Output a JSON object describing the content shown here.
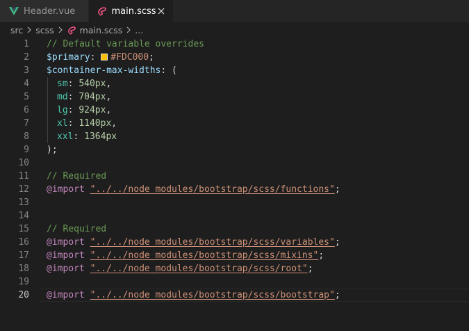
{
  "tabs": [
    {
      "label": "Header.vue",
      "icon": "vue-icon",
      "active": false
    },
    {
      "label": "main.scss",
      "icon": "sass-icon",
      "active": true
    }
  ],
  "breadcrumb": {
    "items": [
      "src",
      "scss",
      "main.scss",
      "..."
    ]
  },
  "editor": {
    "current_line": 20,
    "lines": [
      {
        "n": "1",
        "tokens": [
          {
            "t": "comment",
            "v": "// Default variable overrides"
          }
        ]
      },
      {
        "n": "2",
        "tokens": [
          {
            "t": "var",
            "v": "$primary"
          },
          {
            "t": "punc",
            "v": ": "
          },
          {
            "t": "swatch",
            "v": "#FDC000"
          },
          {
            "t": "hex",
            "v": "#FDC000"
          },
          {
            "t": "punc",
            "v": ";"
          }
        ]
      },
      {
        "n": "3",
        "tokens": [
          {
            "t": "var",
            "v": "$container-max-widths"
          },
          {
            "t": "punc",
            "v": ": ("
          }
        ]
      },
      {
        "n": "4",
        "tokens": [
          {
            "t": "indent"
          },
          {
            "t": "key",
            "v": "sm"
          },
          {
            "t": "punc",
            "v": ": "
          },
          {
            "t": "num",
            "v": "540px"
          },
          {
            "t": "punc",
            "v": ","
          }
        ]
      },
      {
        "n": "5",
        "tokens": [
          {
            "t": "indent"
          },
          {
            "t": "key",
            "v": "md"
          },
          {
            "t": "punc",
            "v": ": "
          },
          {
            "t": "num",
            "v": "704px"
          },
          {
            "t": "punc",
            "v": ","
          }
        ]
      },
      {
        "n": "6",
        "tokens": [
          {
            "t": "indent"
          },
          {
            "t": "key",
            "v": "lg"
          },
          {
            "t": "punc",
            "v": ": "
          },
          {
            "t": "num",
            "v": "924px"
          },
          {
            "t": "punc",
            "v": ","
          }
        ]
      },
      {
        "n": "7",
        "tokens": [
          {
            "t": "indent"
          },
          {
            "t": "key",
            "v": "xl"
          },
          {
            "t": "punc",
            "v": ": "
          },
          {
            "t": "num",
            "v": "1140px"
          },
          {
            "t": "punc",
            "v": ","
          }
        ]
      },
      {
        "n": "8",
        "tokens": [
          {
            "t": "indent"
          },
          {
            "t": "key",
            "v": "xxl"
          },
          {
            "t": "punc",
            "v": ": "
          },
          {
            "t": "num",
            "v": "1364px"
          }
        ]
      },
      {
        "n": "9",
        "tokens": [
          {
            "t": "punc",
            "v": ");"
          }
        ]
      },
      {
        "n": "10",
        "tokens": []
      },
      {
        "n": "11",
        "tokens": [
          {
            "t": "comment",
            "v": "// Required"
          }
        ]
      },
      {
        "n": "12",
        "tokens": [
          {
            "t": "at",
            "v": "@import"
          },
          {
            "t": "punc",
            "v": " "
          },
          {
            "t": "str",
            "v": "\"../../node_modules/bootstrap/scss/functions\""
          },
          {
            "t": "punc",
            "v": ";"
          }
        ]
      },
      {
        "n": "13",
        "tokens": []
      },
      {
        "n": "14",
        "tokens": []
      },
      {
        "n": "15",
        "tokens": [
          {
            "t": "comment",
            "v": "// Required"
          }
        ]
      },
      {
        "n": "16",
        "tokens": [
          {
            "t": "at",
            "v": "@import"
          },
          {
            "t": "punc",
            "v": " "
          },
          {
            "t": "str",
            "v": "\"../../node_modules/bootstrap/scss/variables\""
          },
          {
            "t": "punc",
            "v": ";"
          }
        ]
      },
      {
        "n": "17",
        "tokens": [
          {
            "t": "at",
            "v": "@import"
          },
          {
            "t": "punc",
            "v": " "
          },
          {
            "t": "str",
            "v": "\"../../node_modules/bootstrap/scss/mixins\""
          },
          {
            "t": "punc",
            "v": ";"
          }
        ]
      },
      {
        "n": "18",
        "tokens": [
          {
            "t": "at",
            "v": "@import"
          },
          {
            "t": "punc",
            "v": " "
          },
          {
            "t": "str",
            "v": "\"../../node_modules/bootstrap/scss/root\""
          },
          {
            "t": "punc",
            "v": ";"
          }
        ]
      },
      {
        "n": "19",
        "tokens": []
      },
      {
        "n": "20",
        "tokens": [
          {
            "t": "at",
            "v": "@import"
          },
          {
            "t": "punc",
            "v": " "
          },
          {
            "t": "str",
            "v": "\"../../node_modules/bootstrap/scss/bootstrap\""
          },
          {
            "t": "punc",
            "v": ";"
          }
        ]
      }
    ]
  },
  "colors": {
    "vue_green": "#41b883",
    "vue_dark": "#35495e",
    "sass_pink": "#f55385",
    "swatch": "#FDC000"
  }
}
